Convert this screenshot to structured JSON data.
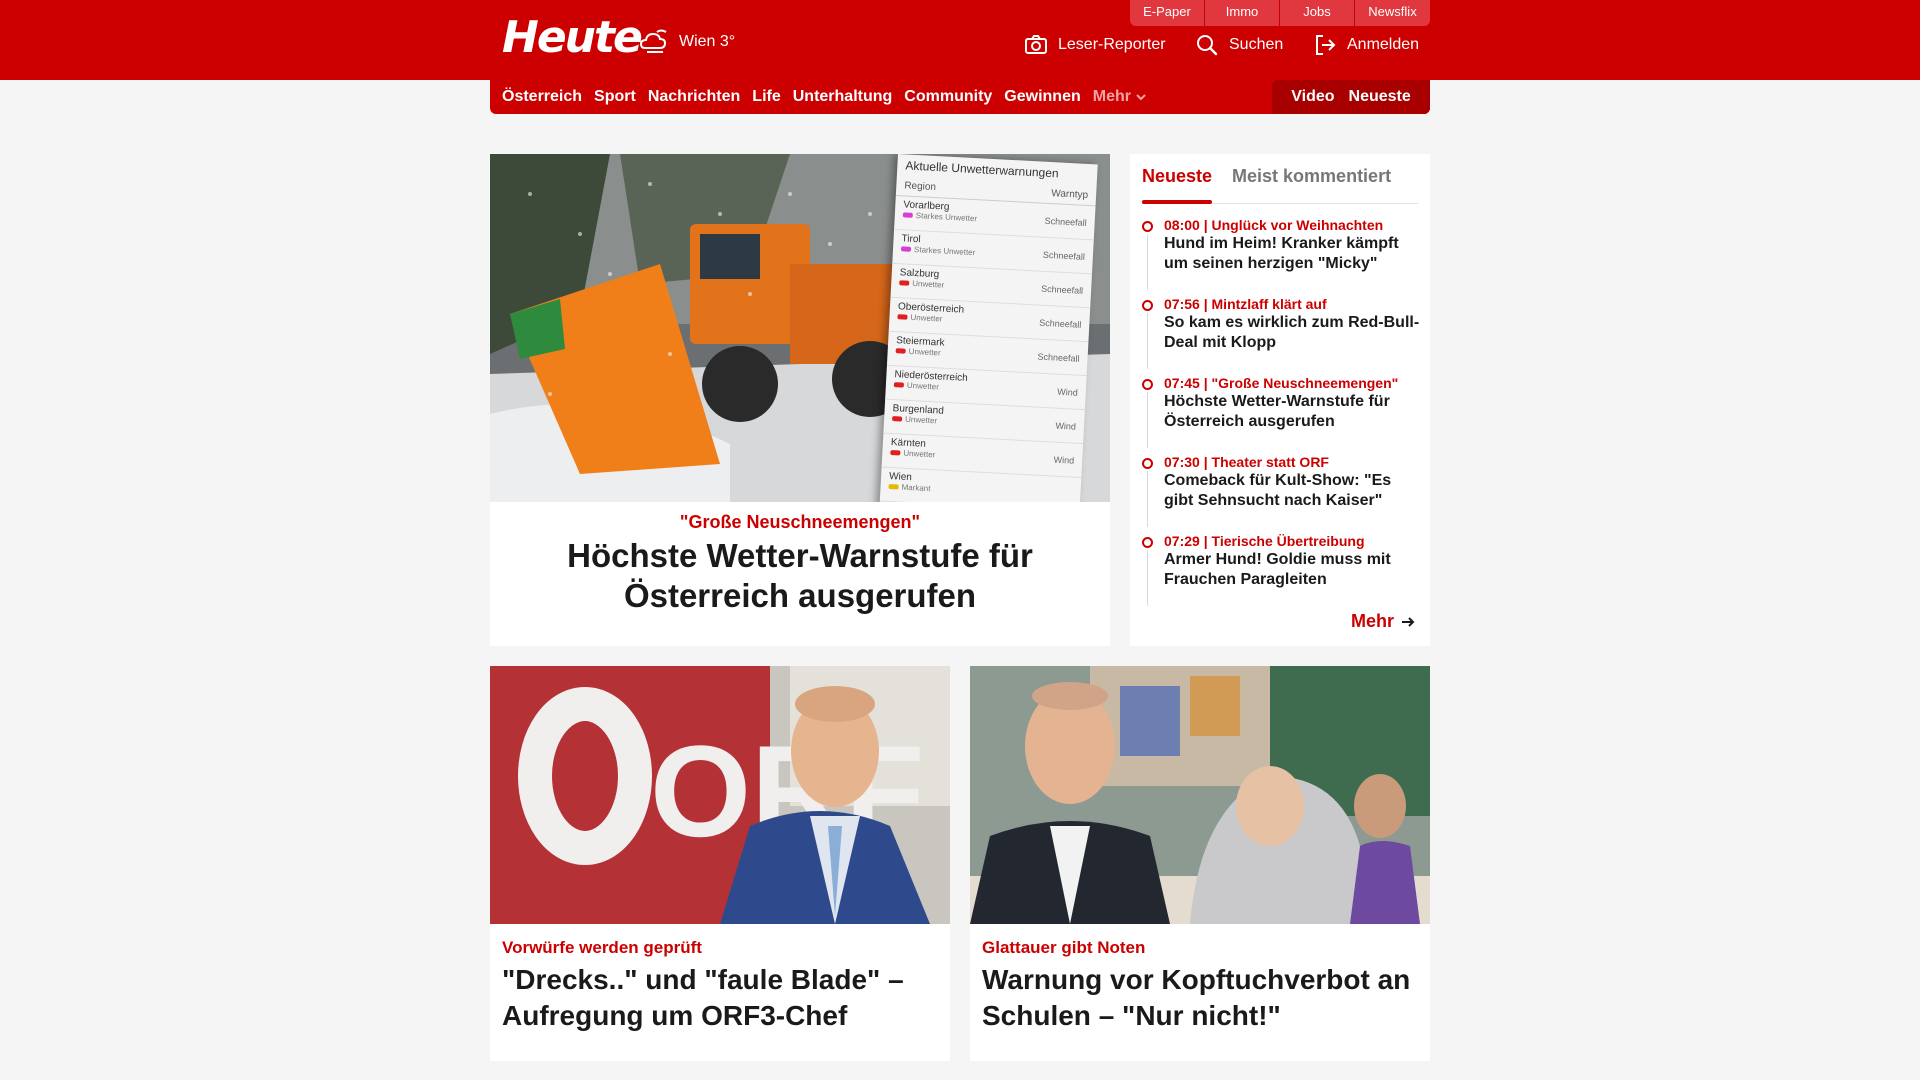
{
  "header": {
    "logo": "Heute",
    "weather": "Wien 3°",
    "quick_links": [
      "E-Paper",
      "Immo",
      "Jobs",
      "Newsflix"
    ],
    "actions": [
      {
        "label": "Leser-Reporter",
        "icon": "camera-icon"
      },
      {
        "label": "Suchen",
        "icon": "search-icon"
      },
      {
        "label": "Anmelden",
        "icon": "login-icon"
      }
    ]
  },
  "nav": {
    "items": [
      "Österreich",
      "Sport",
      "Nachrichten",
      "Life",
      "Unterhaltung",
      "Community",
      "Gewinnen"
    ],
    "more": "Mehr",
    "right": [
      "Video",
      "Neueste"
    ]
  },
  "hero": {
    "kicker": "\"Große Neuschneemengen\"",
    "title": "Höchste Wetter-Warnstufe für Österreich ausgerufen",
    "warn_table": {
      "title": "Aktuelle Unwetterwarnungen",
      "col_region": "Region",
      "col_type": "Warntyp",
      "rows": [
        {
          "region": "Vorarlberg",
          "level": "Starkes Unwetter",
          "type": "Schneefall",
          "color": "#d63fd6"
        },
        {
          "region": "Tirol",
          "level": "Starkes Unwetter",
          "type": "Schneefall",
          "color": "#d63fd6"
        },
        {
          "region": "Salzburg",
          "level": "Unwetter",
          "type": "Schneefall",
          "color": "#e02020"
        },
        {
          "region": "Oberösterreich",
          "level": "Unwetter",
          "type": "Schneefall",
          "color": "#e02020"
        },
        {
          "region": "Steiermark",
          "level": "Unwetter",
          "type": "Schneefall",
          "color": "#e02020"
        },
        {
          "region": "Niederösterreich",
          "level": "Unwetter",
          "type": "Wind",
          "color": "#e02020"
        },
        {
          "region": "Burgenland",
          "level": "Unwetter",
          "type": "Wind",
          "color": "#e02020"
        },
        {
          "region": "Kärnten",
          "level": "Unwetter",
          "type": "Wind",
          "color": "#e02020"
        },
        {
          "region": "Wien",
          "level": "Markant",
          "type": "",
          "color": "#e6b800"
        }
      ]
    }
  },
  "sidebar": {
    "tabs": [
      "Neueste",
      "Meist kommentiert"
    ],
    "items": [
      {
        "time": "08:00",
        "kicker": "Unglück vor Weihnachten",
        "title": "Hund im Heim! Kranker kämpft um seinen herzigen \"Micky\""
      },
      {
        "time": "07:56",
        "kicker": "Mintzlaff klärt auf",
        "title": "So kam es wirklich zum Red-Bull-Deal mit Klopp"
      },
      {
        "time": "07:45",
        "kicker": "\"Große Neuschneemengen\"",
        "title": "Höchste Wetter-Warnstufe für Österreich ausgerufen"
      },
      {
        "time": "07:30",
        "kicker": "Theater statt ORF",
        "title": "Comeback für Kult-Show: \"Es gibt Sehnsucht nach Kaiser\""
      },
      {
        "time": "07:29",
        "kicker": "Tierische Übertreibung",
        "title": "Armer Hund! Goldie muss mit Frauchen Paragleiten"
      }
    ],
    "more": "Mehr"
  },
  "cards": [
    {
      "kicker": "Vorwürfe werden geprüft",
      "title": "\"Drecks..\" und \"faule Blade\" – Aufregung um ORF3-Chef",
      "image_text": "ORF"
    },
    {
      "kicker": "Glattauer gibt Noten",
      "title": "Warnung vor Kopftuchverbot an Schulen – \"Nur nicht!\""
    }
  ],
  "colors": {
    "brand": "#cc0000",
    "brand_dark": "#a80000",
    "quick_bg": "#e0383e"
  }
}
